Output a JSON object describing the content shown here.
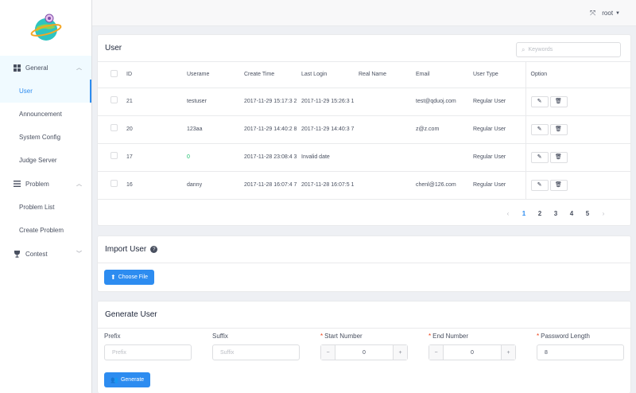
{
  "header": {
    "user": "root",
    "fullscreen_icon": "expand-icon",
    "caret_icon": "caret-down-icon"
  },
  "sidebar": {
    "groups": [
      {
        "label": "General",
        "icon": "grid-icon",
        "items": [
          "User",
          "Announcement",
          "System Config",
          "Judge Server"
        ]
      },
      {
        "label": "Problem",
        "icon": "list-icon",
        "items": [
          "Problem List",
          "Create Problem"
        ]
      },
      {
        "label": "Contest",
        "icon": "trophy-icon",
        "items": []
      }
    ]
  },
  "user_panel": {
    "title": "User",
    "search_placeholder": "Keywords",
    "columns": [
      "ID",
      "Userame",
      "Create Time",
      "Last Login",
      "Real Name",
      "Email",
      "User Type",
      "Option"
    ],
    "rows": [
      {
        "id": "21",
        "username": "testuser",
        "create_time": "2017-11-29 15:17:3 2",
        "last_login": "2017-11-29 15:26:3 1",
        "real_name": "",
        "email": "test@qduoj.com",
        "user_type": "Regular User"
      },
      {
        "id": "20",
        "username": "123aa",
        "create_time": "2017-11-29 14:40:2 8",
        "last_login": "2017-11-29 14:40:3 7",
        "real_name": "",
        "email": "z@z.com",
        "user_type": "Regular User"
      },
      {
        "id": "17",
        "username": "0",
        "create_time": "2017-11-28 23:08:4 3",
        "last_login": "Invalid date",
        "real_name": "",
        "email": "",
        "user_type": "Regular User"
      },
      {
        "id": "16",
        "username": "danny",
        "create_time": "2017-11-28 16:07:4 7",
        "last_login": "2017-11-28 16:07:5 1",
        "real_name": "",
        "email": "chenl@126.com",
        "user_type": "Regular User"
      }
    ],
    "pagination": {
      "prev": "‹",
      "pages": [
        "1",
        "2",
        "3",
        "4",
        "5"
      ],
      "current": "1",
      "next": "›"
    }
  },
  "import_panel": {
    "title": "Import User",
    "help_icon": "question-circle-icon",
    "button": "Choose File"
  },
  "generate_panel": {
    "title": "Generate User",
    "prefix": {
      "label": "Prefix",
      "placeholder": "Prefix"
    },
    "suffix": {
      "label": "Suffix",
      "placeholder": "Suffix"
    },
    "start_number": {
      "label": "Start Number",
      "value": "0"
    },
    "end_number": {
      "label": "End Number",
      "value": "0"
    },
    "password_length": {
      "label": "Password Length",
      "value": "8"
    },
    "button": "Generate"
  },
  "colors": {
    "primary": "#2d8cf0",
    "green_text": "#19be6b",
    "danger": "#ed3f14"
  }
}
